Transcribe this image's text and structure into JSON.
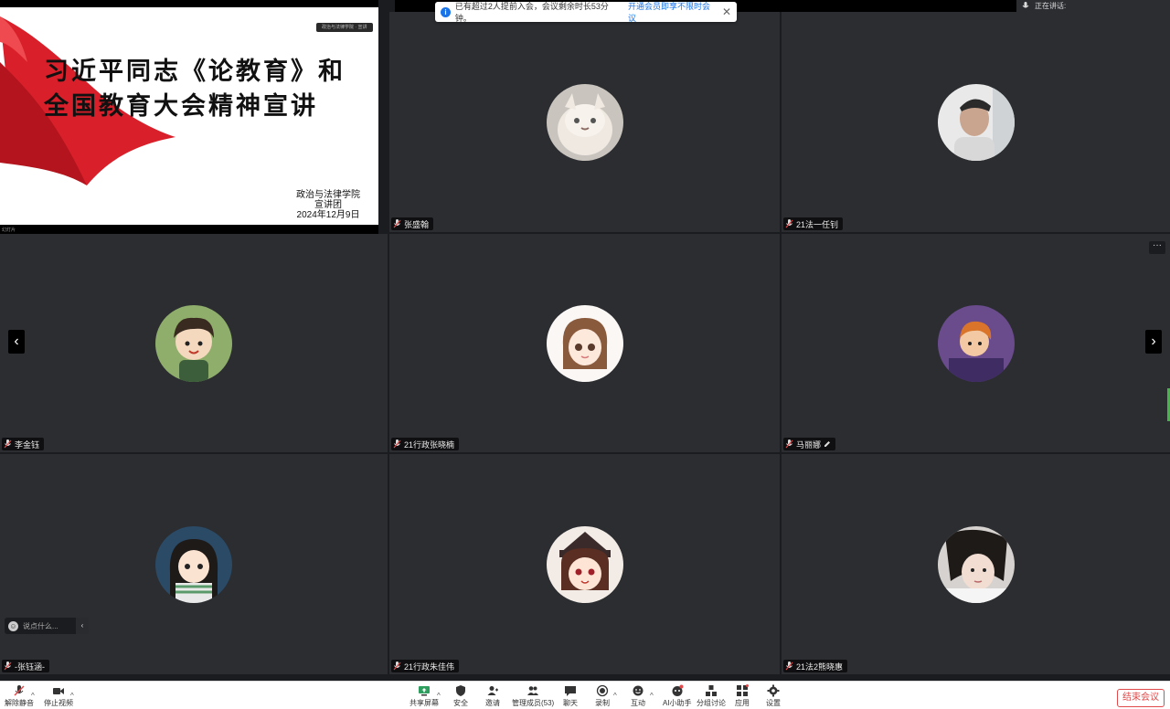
{
  "slide": {
    "title_line1": "习近平同志《论教育》和",
    "title_line2": "全国教育大会精神宣讲",
    "org": "政治与法律学院",
    "team": "宣讲团",
    "date": "2024年12月9日",
    "mini_label": "政治与法律学院 · 宣讲",
    "strip_label": "幻灯片"
  },
  "notice": {
    "text": "已有超过2人提前入会，会议剩余时长53分钟。",
    "link": "开通会员即享不限时会议",
    "close": "✕"
  },
  "speaking": {
    "label": "正在讲话:"
  },
  "participants": [
    {
      "name": "张盛翰"
    },
    {
      "name": "21法一任钊"
    },
    {
      "name": "李金钰"
    },
    {
      "name": "21行政张晓楠"
    },
    {
      "name": "马丽娜"
    },
    {
      "name": "-张钰涵-"
    },
    {
      "name": "21行政朱佳伟"
    },
    {
      "name": "21法2熊晓惠"
    }
  ],
  "nav": {
    "prev": "‹",
    "next": "›",
    "more": "···"
  },
  "chat": {
    "placeholder": "说点什么...",
    "collapse": "‹"
  },
  "toolbar": {
    "mute": "解除静音",
    "video": "停止视频",
    "share": "共享屏幕",
    "security": "安全",
    "invite": "邀请",
    "members": "管理成员(53)",
    "chat": "聊天",
    "record": "录制",
    "reaction": "互动",
    "ai": "AI小助手",
    "breakout": "分组讨论",
    "apps": "应用",
    "settings": "设置",
    "end": "结束会议"
  },
  "colors": {
    "tile": "#2b2d31",
    "accent": "#1a73e8",
    "end": "#e04a4a",
    "ribbon": "#d9202a"
  }
}
